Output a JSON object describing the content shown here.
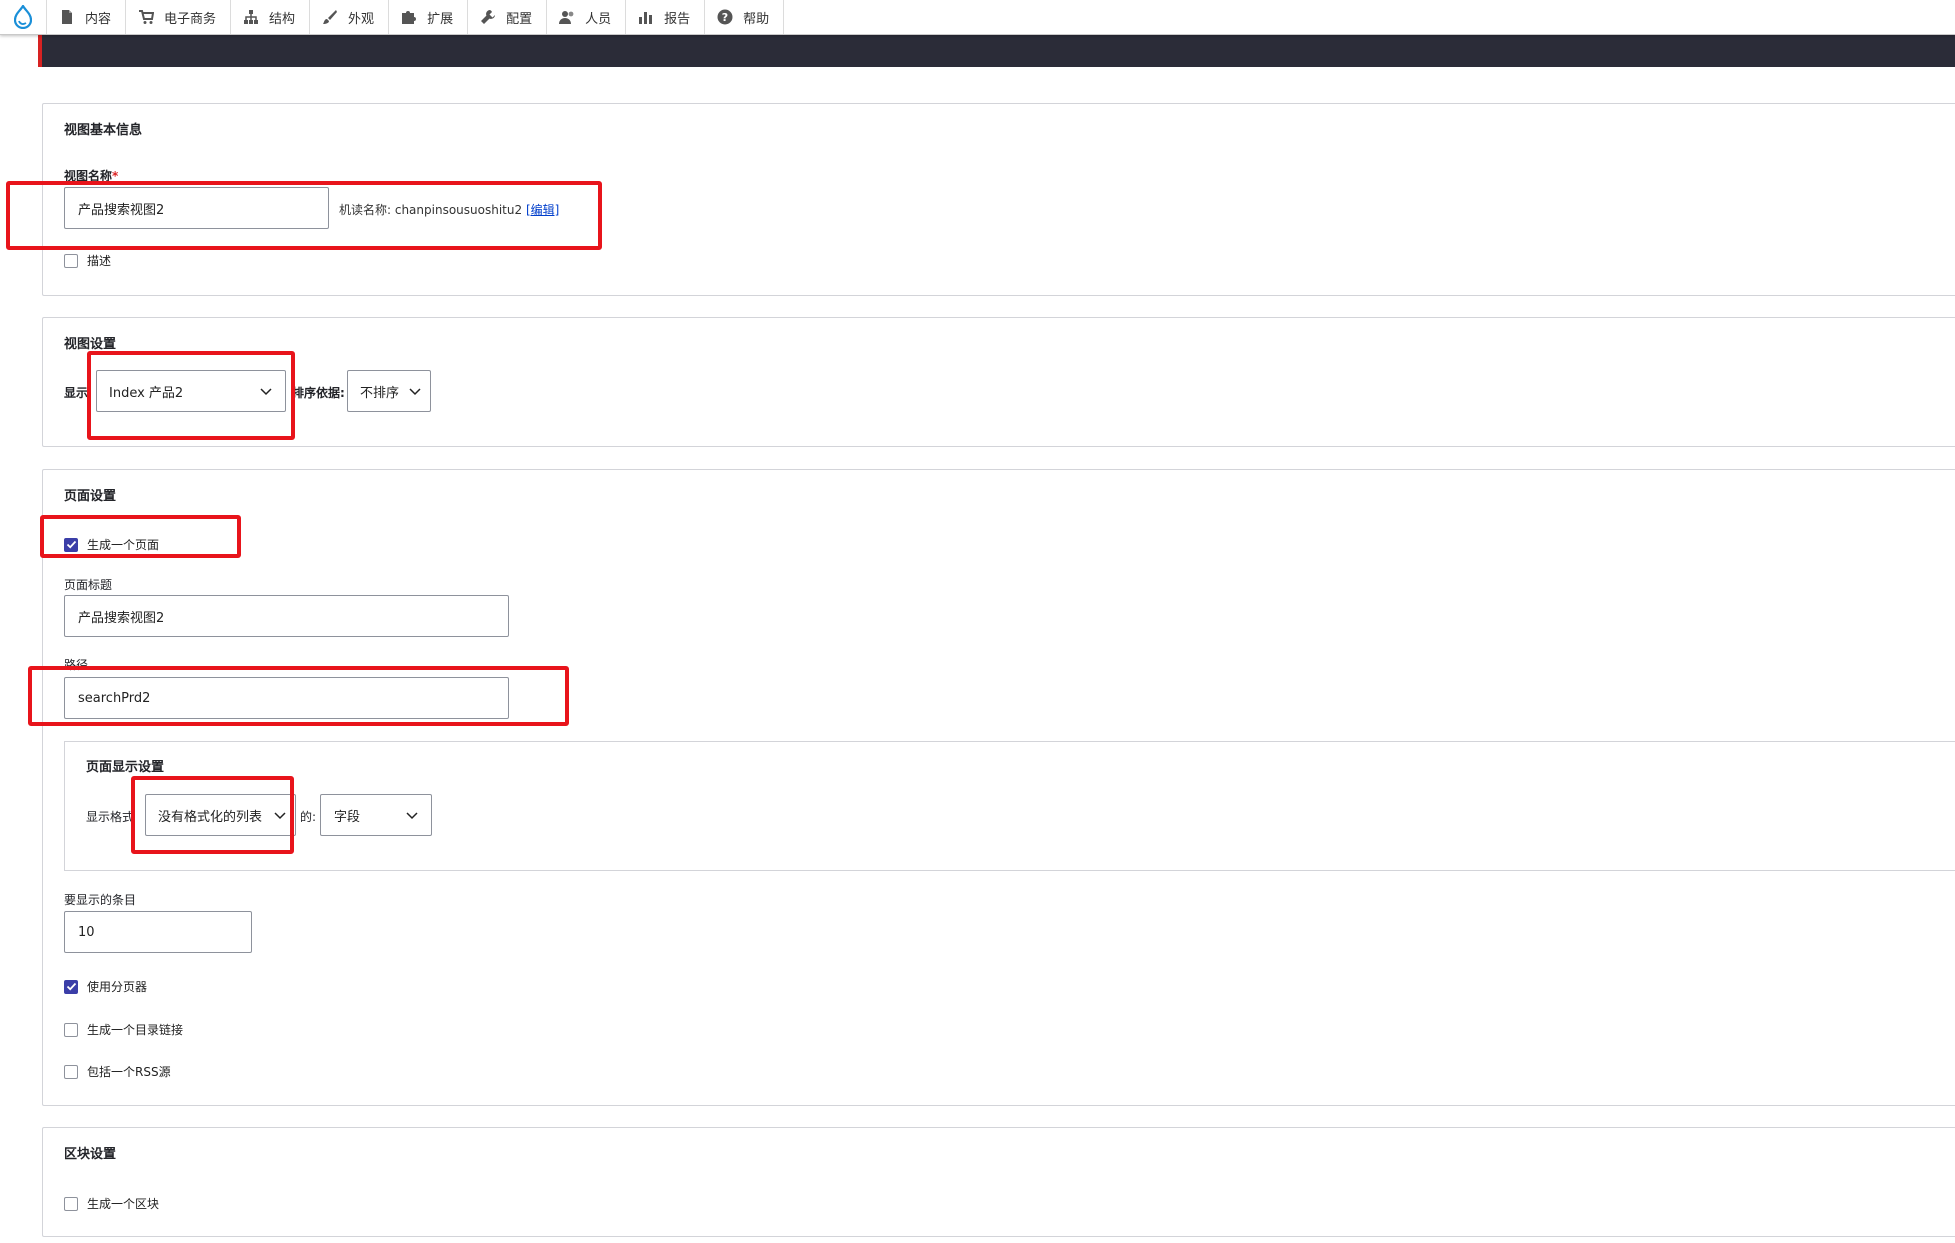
{
  "toolbar": {
    "logo": "drupal-drop-icon",
    "items": [
      {
        "label": "内容",
        "icon": "file-icon"
      },
      {
        "label": "电子商务",
        "icon": "cart-icon"
      },
      {
        "label": "结构",
        "icon": "sitemap-icon"
      },
      {
        "label": "外观",
        "icon": "brush-icon"
      },
      {
        "label": "扩展",
        "icon": "puzzle-icon"
      },
      {
        "label": "配置",
        "icon": "wrench-icon"
      },
      {
        "label": "人员",
        "icon": "people-icon"
      },
      {
        "label": "报告",
        "icon": "bar-chart-icon"
      },
      {
        "label": "帮助",
        "icon": "help-icon"
      }
    ]
  },
  "basic_info": {
    "title": "视图基本信息",
    "view_name_label": "视图名称",
    "required_mark": "*",
    "view_name_value": "产品搜索视图2",
    "machine_name_prefix": "机读名称: chanpinsousuoshitu2",
    "machine_name_edit": "[编辑]",
    "description_label": "描述",
    "description_checked": false
  },
  "view_settings": {
    "title": "视图设置",
    "show_label": "显示",
    "show_value": "Index 产品2",
    "sort_label": "排序依据:",
    "sort_value": "不排序"
  },
  "page_settings": {
    "title": "页面设置",
    "create_page_label": "生成一个页面",
    "create_page_checked": true,
    "page_title_label": "页面标题",
    "page_title_value": "产品搜索视图2",
    "path_label": "路径",
    "path_value": "searchPrd2",
    "display": {
      "title": "页面显示设置",
      "format_label": "显示格式",
      "format_value": "没有格式化的列表",
      "of_label": "的:",
      "of_value": "字段"
    },
    "items_label": "要显示的条目",
    "items_value": "10",
    "pager_label": "使用分页器",
    "pager_checked": true,
    "menu_link_label": "生成一个目录链接",
    "menu_link_checked": false,
    "rss_label": "包括一个RSS源",
    "rss_checked": false
  },
  "block_settings": {
    "title": "区块设置",
    "create_block_label": "生成一个区块",
    "create_block_checked": false
  },
  "colors": {
    "accent": "#3b3ea8",
    "highlight": "#e8141b",
    "dark_bar": "#2b2c38"
  }
}
